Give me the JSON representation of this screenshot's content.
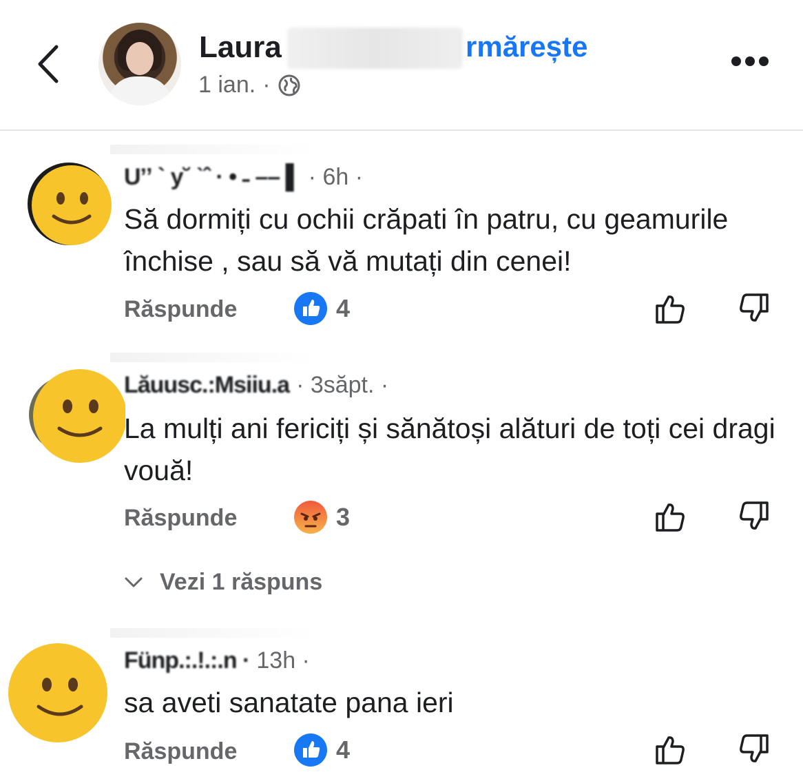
{
  "header": {
    "back_icon": "chevron-left-icon",
    "author_name": "Laura",
    "follow_label": "rmărește",
    "date": "1 ian.",
    "separator": "·",
    "privacy_icon": "globe-icon",
    "more_icon": "more-horizontal-icon"
  },
  "colors": {
    "accent": "#1877f2",
    "secondary_text": "#65676b",
    "primary_text": "#1c1e21",
    "divider": "#e4e6eb"
  },
  "comments": [
    {
      "avatar_icon": "smiling-face-emoji",
      "name": "U’ʼ ` y˘ ˋˆ · • ˗ –– ▌",
      "time": "· 6h ·",
      "text": "Să dormiți cu ochii crăpati în patru, cu geamurile închise , sau să vă mutați din cenei!",
      "reply_label": "Răspunde",
      "reaction_icon": "like-reaction-icon",
      "reaction_count": "4"
    },
    {
      "avatar_icon": "smiling-face-emoji",
      "name": "Lăuusc.:Msiiu.a",
      "time": "· 3săpt. ·",
      "text": "La mulți ani fericiți și sănătoși alături de toți cei dragi vouă!",
      "reply_label": "Răspunde",
      "reaction_icon": "angry-reaction-icon",
      "reaction_count": "3",
      "view_replies_label": "Vezi 1 răspuns"
    },
    {
      "avatar_icon": "smiling-face-emoji",
      "name": "Fünp.:.!.:.n ·",
      "time": "13h ·",
      "text": "sa aveti sanatate pana ieri",
      "reply_label": "Răspunde",
      "reaction_icon": "like-reaction-icon",
      "reaction_count": "4"
    }
  ],
  "actions": {
    "like_icon": "thumbs-up-outline-icon",
    "dislike_icon": "thumbs-down-outline-icon"
  }
}
